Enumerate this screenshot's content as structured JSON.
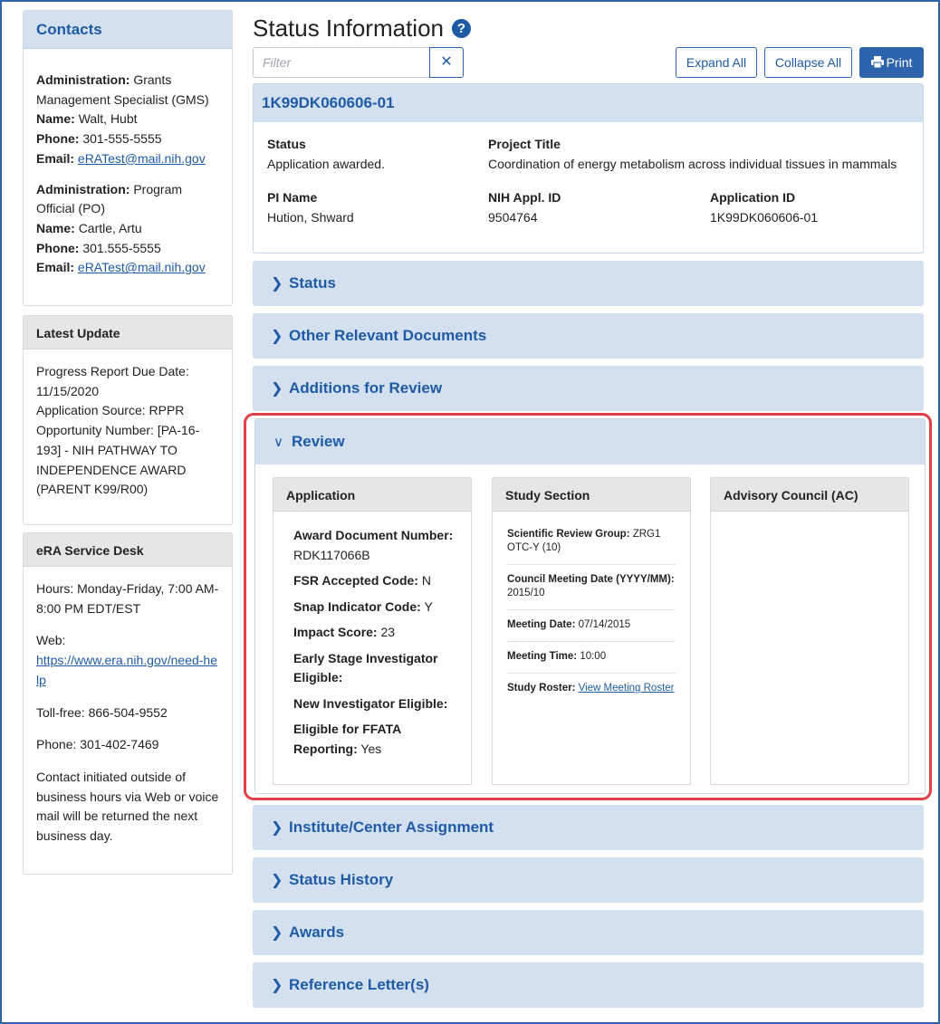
{
  "contacts": {
    "title": "Contacts",
    "entries": [
      {
        "admin_label": "Administration:",
        "admin_value": "Grants Management Specialist (GMS)",
        "name_label": "Name:",
        "name_value": "Walt, Hubt",
        "phone_label": "Phone:",
        "phone_value": "301-555-5555",
        "email_label": "Email:",
        "email_value": "eRATest@mail.nih.gov"
      },
      {
        "admin_label": "Administration:",
        "admin_value": "Program Official (PO)",
        "name_label": "Name:",
        "name_value": "Cartle, Artu",
        "phone_label": "Phone:",
        "phone_value": "301.555-5555",
        "email_label": "Email:",
        "email_value": "eRATest@mail.nih.gov"
      }
    ]
  },
  "latest_update": {
    "title": "Latest Update",
    "progress_report": "Progress Report Due Date: 11/15/2020",
    "application_source": "Application Source: RPPR",
    "opportunity": "Opportunity Number: [PA-16-193] -  NIH PATHWAY TO INDEPENDENCE AWARD (PARENT K99/R00)"
  },
  "service_desk": {
    "title": "eRA Service Desk",
    "hours": "Hours: Monday-Friday, 7:00 AM-8:00 PM EDT/EST",
    "web_label": "Web:",
    "web_link": "https://www.era.nih.gov/need-help",
    "toll_free": "Toll-free: 866-504-9552",
    "phone": "Phone: 301-402-7469",
    "note": "Contact initiated outside of business hours via Web or voice mail will be returned the next business day."
  },
  "page": {
    "title": "Status Information",
    "help_icon": "?"
  },
  "toolbar": {
    "filter_placeholder": "Filter",
    "clear_icon": "✕",
    "expand_all": "Expand All",
    "collapse_all": "Collapse All",
    "print": "Print"
  },
  "project": {
    "grant_number": "1K99DK060606-01",
    "status_label": "Status",
    "status_value": "Application awarded.",
    "title_label": "Project Title",
    "title_value": "Coordination of energy metabolism across individual tissues in mammals",
    "pi_label": "PI Name",
    "pi_value": "Hution, Shward",
    "appl_id_label": "NIH Appl. ID",
    "appl_id_value": "9504764",
    "application_id_label": "Application ID",
    "application_id_value": "1K99DK060606-01"
  },
  "sections_top": [
    "Status",
    "Other Relevant Documents",
    "Additions for Review"
  ],
  "review": {
    "label": "Review",
    "application": {
      "title": "Application",
      "award_doc_label": "Award Document Number:",
      "award_doc_value": "RDK117066B",
      "fsr_label": "FSR Accepted Code:",
      "fsr_value": "N",
      "snap_label": "Snap Indicator Code:",
      "snap_value": "Y",
      "impact_label": "Impact Score:",
      "impact_value": "23",
      "esi_label": "Early Stage Investigator Eligible:",
      "ni_label": "New Investigator Eligible:",
      "ffata_label": "Eligible for FFATA Reporting:",
      "ffata_value": "Yes"
    },
    "study_section": {
      "title": "Study Section",
      "srg_label": "Scientific Review Group:",
      "srg_value": "ZRG1 OTC-Y (10)",
      "council_label": "Council Meeting Date (YYYY/MM):",
      "council_value": "2015/10",
      "meeting_date_label": "Meeting Date:",
      "meeting_date_value": "07/14/2015",
      "meeting_time_label": "Meeting Time:",
      "meeting_time_value": "10:00",
      "roster_label": "Study Roster:",
      "roster_link": "View Meeting Roster"
    },
    "advisory": {
      "title": "Advisory Council (AC)"
    }
  },
  "sections_bottom": [
    "Institute/Center Assignment",
    "Status History",
    "Awards",
    "Reference Letter(s)"
  ],
  "icons": {
    "chevron_right": "chevron-right-icon",
    "chevron_down": "chevron-down-icon",
    "print": "printer-icon"
  },
  "colors": {
    "accent": "#2e63ad",
    "section_bg": "#d3e0f0",
    "highlight": "#e04048"
  }
}
